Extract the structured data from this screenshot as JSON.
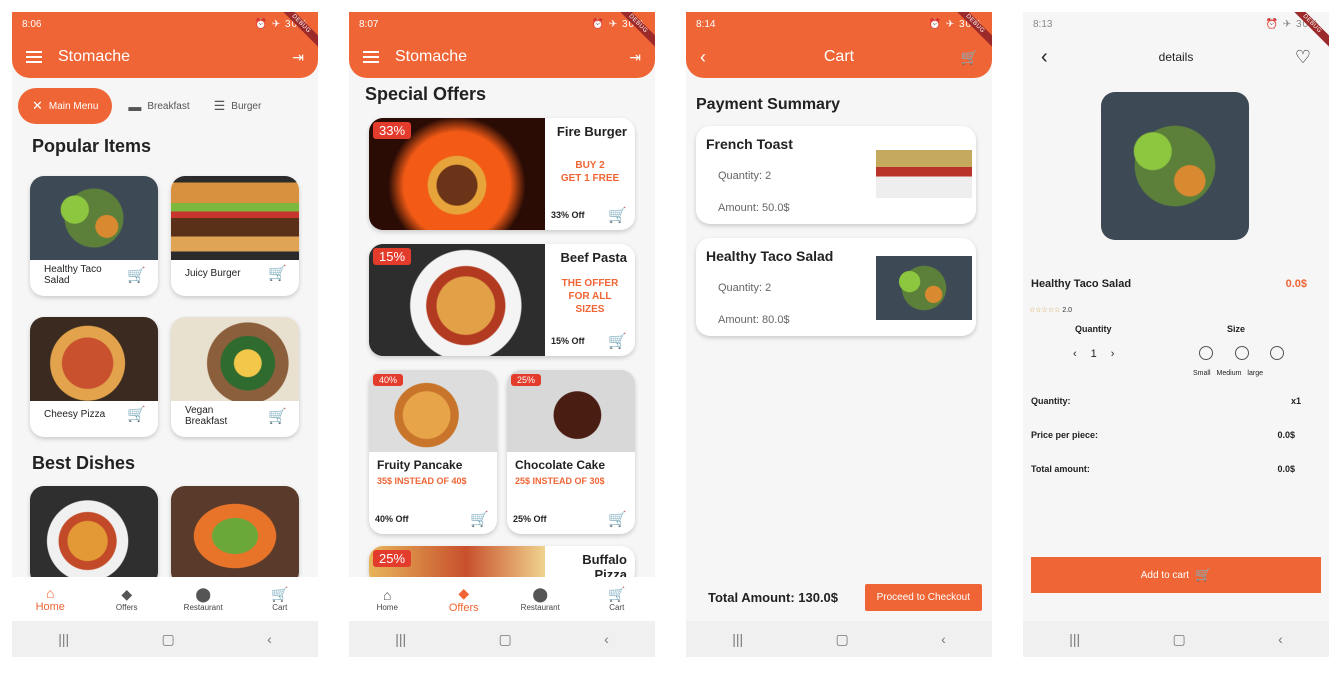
{
  "app_title": "Stomache",
  "brand_color": "#ef6535",
  "debug_label": "DEBUG",
  "screens": {
    "home": {
      "time": "8:06",
      "status": "⏰ ✈ 30%",
      "chips": [
        {
          "label": "Main Menu",
          "icon": "fork-knife-icon"
        },
        {
          "label": "Breakfast",
          "icon": "toaster-icon"
        },
        {
          "label": "Burger",
          "icon": "burger-icon"
        }
      ],
      "popular_title": "Popular Items",
      "popular": [
        {
          "name": "Healthy Taco Salad"
        },
        {
          "name": "Juicy Burger"
        },
        {
          "name": "Cheesy Pizza"
        },
        {
          "name": "Vegan Breakfast"
        }
      ],
      "best_title": "Best Dishes"
    },
    "offers": {
      "time": "8:07",
      "status": "⏰ ✈ 30%",
      "title": "Special Offers",
      "big": [
        {
          "pct": "33%",
          "name": "Fire Burger",
          "desc": "BUY 2\nGET 1 FREE",
          "foot": "33% Off"
        },
        {
          "pct": "15%",
          "name": "Beef Pasta",
          "desc": "THE OFFER\nFOR ALL\nSIZES",
          "foot": "15% Off"
        }
      ],
      "small": [
        {
          "pct": "40%",
          "name": "Fruity Pancake",
          "desc": "35$ INSTEAD OF 40$",
          "foot": "40% Off"
        },
        {
          "pct": "25%",
          "name": "Chocolate Cake",
          "desc": "25$ INSTEAD OF 30$",
          "foot": "25% Off"
        }
      ],
      "partial": {
        "pct": "25%",
        "name": "Buffalo Pizza"
      }
    },
    "cart": {
      "time": "8:14",
      "status": "⏰ ✈ 30%",
      "title": "Cart",
      "summary_title": "Payment Summary",
      "items": [
        {
          "name": "French Toast",
          "quantity": "Quantity: 2",
          "amount": "Amount: 50.0$"
        },
        {
          "name": "Healthy Taco Salad",
          "quantity": "Quantity: 2",
          "amount": "Amount: 80.0$"
        }
      ],
      "total": "Total Amount: 130.0$",
      "checkout": "Proceed to Checkout"
    },
    "details": {
      "time": "8:13",
      "status": "⏰ ✈ 30%",
      "title": "details",
      "name": "Healthy Taco Salad",
      "price": "0.0$",
      "rating": "2.0",
      "quantity_label": "Quantity",
      "size_label": "Size",
      "qty_value": "1",
      "sizes": [
        "Small",
        "Medium",
        "large"
      ],
      "rows": [
        {
          "label": "Quantity:",
          "value": "x1"
        },
        {
          "label": "Price per piece:",
          "value": "0.0$"
        },
        {
          "label": "Total amount:",
          "value": "0.0$"
        }
      ],
      "add_to_cart": "Add to cart"
    }
  },
  "nav": [
    {
      "label": "Home",
      "icon": "home-icon"
    },
    {
      "label": "Offers",
      "icon": "tag-icon"
    },
    {
      "label": "Restaurant",
      "icon": "location-icon"
    },
    {
      "label": "Cart",
      "icon": "cart-icon"
    }
  ],
  "sys_nav": [
    "recent-apps-icon",
    "home-circle-icon",
    "back-icon"
  ]
}
